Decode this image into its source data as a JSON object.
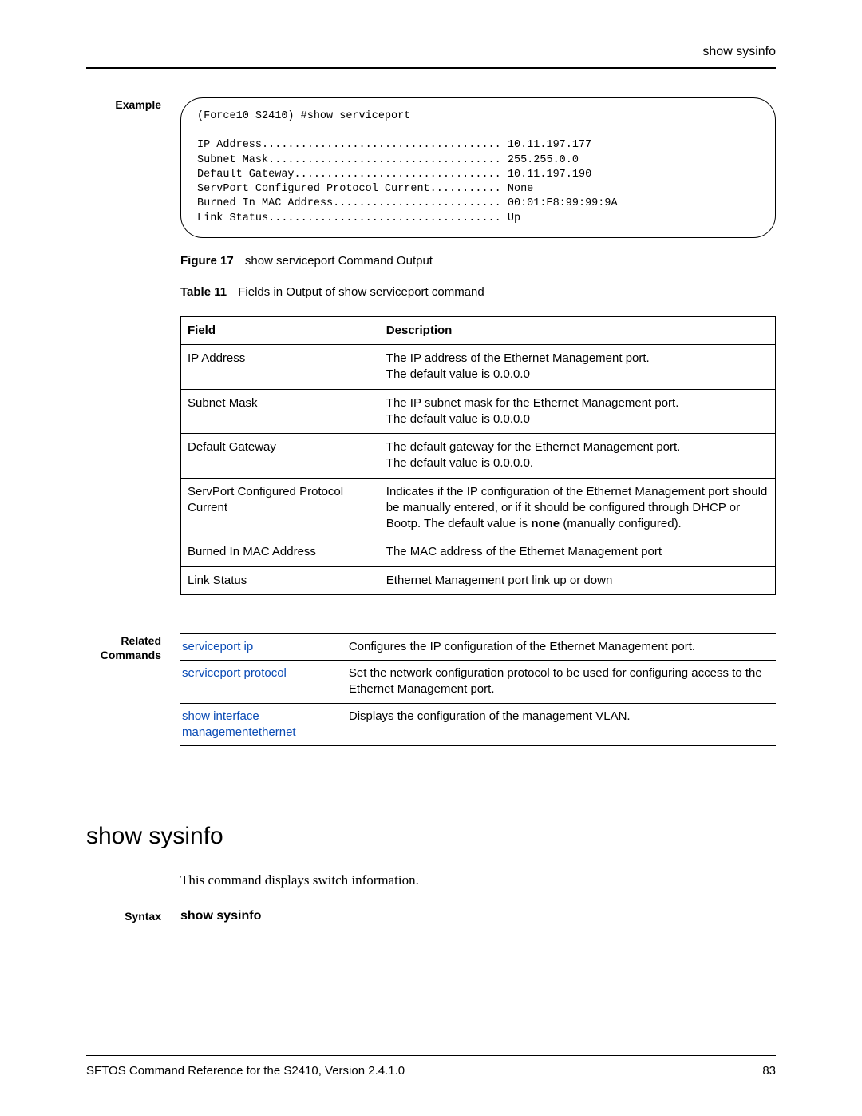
{
  "header": {
    "title": "show sysinfo"
  },
  "labels": {
    "example": "Example",
    "related_commands_l1": "Related",
    "related_commands_l2": "Commands",
    "syntax": "Syntax"
  },
  "code_output": "(Force10 S2410) #show serviceport\n\nIP Address..................................... 10.11.197.177\nSubnet Mask.................................... 255.255.0.0\nDefault Gateway................................ 10.11.197.190\nServPort Configured Protocol Current........... None\nBurned In MAC Address.......................... 00:01:E8:99:99:9A\nLink Status.................................... Up",
  "figure_caption": {
    "label": "Figure 17",
    "text": "show serviceport Command Output"
  },
  "table_caption": {
    "label": "Table 11",
    "text": "Fields in Output of show serviceport command"
  },
  "fields_table": {
    "headers": [
      "Field",
      "Description"
    ],
    "rows": [
      {
        "field": "IP Address",
        "desc": "The IP address of the Ethernet Management port.\nThe default value is 0.0.0.0"
      },
      {
        "field": "Subnet Mask",
        "desc": "The IP subnet mask for the Ethernet Management port.\nThe default value is 0.0.0.0"
      },
      {
        "field": "Default Gateway",
        "desc": "The default gateway for the Ethernet Management port.\nThe default value is 0.0.0.0."
      },
      {
        "field": "ServPort Configured Protocol Current",
        "desc_parts": [
          "Indicates if the IP configuration of the Ethernet Management port should be manually entered, or if it should be configured through DHCP or Bootp. The default value is ",
          "none",
          " (manually configured)."
        ]
      },
      {
        "field": "Burned In MAC Address",
        "desc": "The MAC address of the Ethernet Management port"
      },
      {
        "field": "Link Status",
        "desc": "Ethernet Management port link up or down"
      }
    ]
  },
  "related": {
    "rows": [
      {
        "cmd": "serviceport ip",
        "desc": "Configures the IP configuration of the Ethernet Management port."
      },
      {
        "cmd": "serviceport protocol",
        "desc": "Set the network configuration protocol to be used for configuring access to the Ethernet Management port."
      },
      {
        "cmd": "show interface managementethernet",
        "desc": "Displays the configuration of the management VLAN."
      }
    ]
  },
  "section": {
    "heading": "show sysinfo",
    "body": "This command displays switch information.",
    "syntax_cmd": "show sysinfo"
  },
  "footer": {
    "left": "SFTOS Command Reference for the S2410, Version 2.4.1.0",
    "right": "83"
  }
}
